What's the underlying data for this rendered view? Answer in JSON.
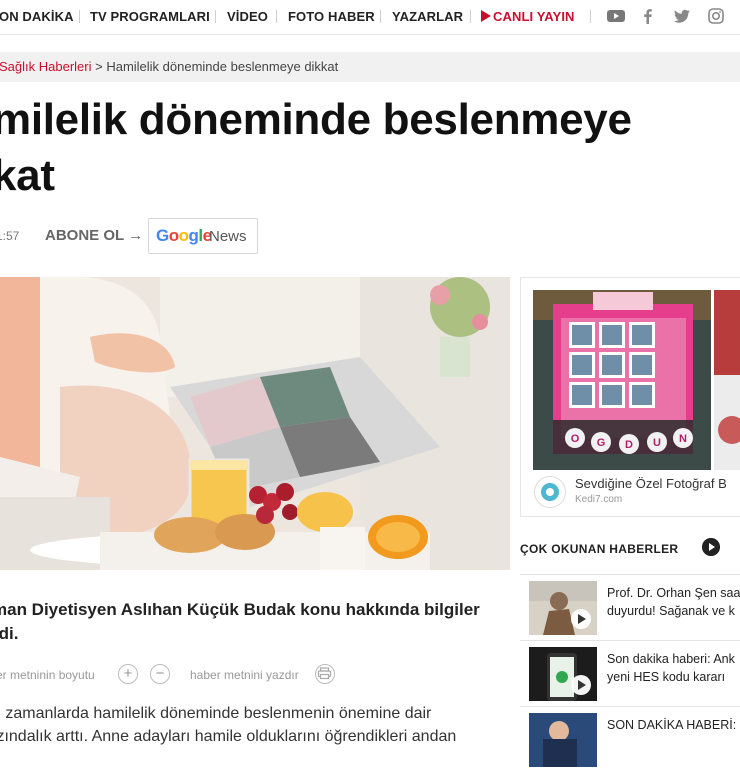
{
  "nav": {
    "items": [
      "ON DAKİKA",
      "TV PROGRAMLARI",
      "VİDEO",
      "FOTO HABER",
      "YAZARLAR"
    ],
    "live_label": "CANLI YAYIN",
    "social": [
      "youtube-icon",
      "facebook-icon",
      "twitter-icon",
      "instagram-icon"
    ]
  },
  "breadcrumb": {
    "category": "Sağlık Haberleri",
    "separator": " > ",
    "current": "Hamilelik döneminde beslenmeye dikkat"
  },
  "article": {
    "title_line1": "milelik döneminde beslenmeye",
    "title_line2": "kat",
    "time": "1:57",
    "subscribe_label": "ABONE OL →",
    "google_news": {
      "google": "Google",
      "news": "News"
    },
    "lead_line1": "man Diyetisyen Aslıhan Küçük Budak konu hakkında bilgiler",
    "lead_line2": "rdi.",
    "tools": {
      "font_size_label": "er metninin boyutu",
      "increase": "+",
      "decrease": "−",
      "print_label": "haber metnini yazdır"
    },
    "body_line1": "n zamanlarda hamilelik döneminde beslenmenin önemine dair",
    "body_line2": "ızındalık arttı. Anne adayları hamile olduklarını öğrendikleri andan"
  },
  "ad": {
    "title": "Sevdiğine Özel Fotoğraf B",
    "source": "Kedi7.com",
    "letters": [
      "O",
      "G",
      "D",
      "U",
      "N"
    ]
  },
  "most_read": {
    "header": "ÇOK OKUNAN HABERLER",
    "items": [
      {
        "line1": "Prof. Dr. Orhan Şen saa",
        "line2": "duyurdu! Sağanak ve k"
      },
      {
        "line1": "Son dakika haberi: Ank",
        "line2": "yeni HES kodu kararı"
      },
      {
        "line1": "SON DAKİKA HABERİ:",
        "line2": ""
      }
    ]
  },
  "colors": {
    "brand_red": "#c8102e",
    "breadcrumb_bg": "#f1f1f1"
  }
}
